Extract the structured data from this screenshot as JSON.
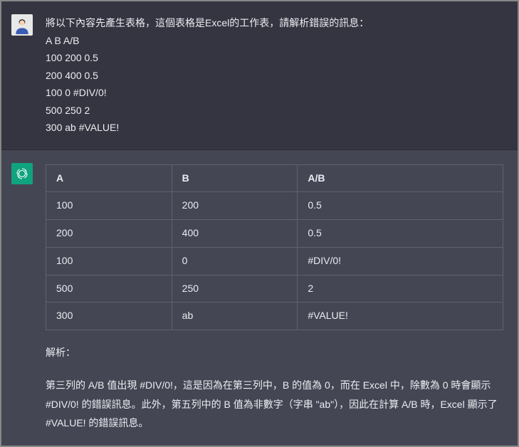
{
  "user": {
    "prompt_lines": [
      "將以下內容先產生表格，這個表格是Excel的工作表，請解析錯誤的訊息：",
      "A B A/B",
      "100 200 0.5",
      "200 400 0.5",
      "100 0  #DIV/0!",
      "500 250 2",
      "300 ab   #VALUE!"
    ]
  },
  "assistant": {
    "table_headers": [
      "A",
      "B",
      "A/B"
    ],
    "table_rows": [
      [
        "100",
        "200",
        "0.5"
      ],
      [
        "200",
        "400",
        "0.5"
      ],
      [
        "100",
        "0",
        "#DIV/0!"
      ],
      [
        "500",
        "250",
        "2"
      ],
      [
        "300",
        "ab",
        "#VALUE!"
      ]
    ],
    "explain_title": "解析：",
    "explain_body": "第三列的 A/B 值出現 #DIV/0!，這是因為在第三列中，B 的值為 0，而在 Excel 中，除數為 0 時會顯示 #DIV/0! 的錯誤訊息。此外，第五列中的 B 值為非數字（字串 \"ab\"），因此在計算 A/B 時，Excel 顯示了 #VALUE! 的錯誤訊息。"
  },
  "chart_data": {
    "type": "table",
    "columns": [
      "A",
      "B",
      "A/B"
    ],
    "rows": [
      {
        "A": 100,
        "B": 200,
        "A/B": 0.5
      },
      {
        "A": 200,
        "B": 400,
        "A/B": 0.5
      },
      {
        "A": 100,
        "B": 0,
        "A/B": "#DIV/0!"
      },
      {
        "A": 500,
        "B": 250,
        "A/B": 2
      },
      {
        "A": 300,
        "B": "ab",
        "A/B": "#VALUE!"
      }
    ]
  }
}
